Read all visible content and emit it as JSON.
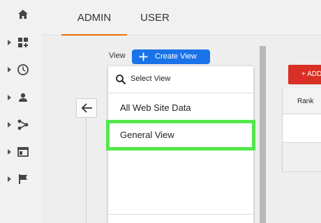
{
  "tabs": [
    {
      "label": "ADMIN",
      "active": true
    },
    {
      "label": "USER",
      "active": false
    }
  ],
  "rail": {
    "items": [
      {
        "icon": "home-icon",
        "expandable": false
      },
      {
        "icon": "dashboard-add-icon",
        "expandable": true
      },
      {
        "icon": "clock-icon",
        "expandable": true
      },
      {
        "icon": "person-icon",
        "expandable": true
      },
      {
        "icon": "share-nodes-icon",
        "expandable": true
      },
      {
        "icon": "window-icon",
        "expandable": true
      },
      {
        "icon": "flag-icon",
        "expandable": true
      }
    ]
  },
  "view_selector": {
    "label": "View",
    "create_button": "Create View",
    "search_placeholder": "Select View",
    "options": [
      "All Web Site Data",
      "General View"
    ],
    "highlighted_option": "General View"
  },
  "right_panel": {
    "add_button": "+ ADD",
    "column_header": "Rank"
  },
  "colors": {
    "accent_tab": "#e8710a",
    "primary_button": "#1a73e8",
    "add_button": "#d93025",
    "highlight": "#55e84c"
  }
}
